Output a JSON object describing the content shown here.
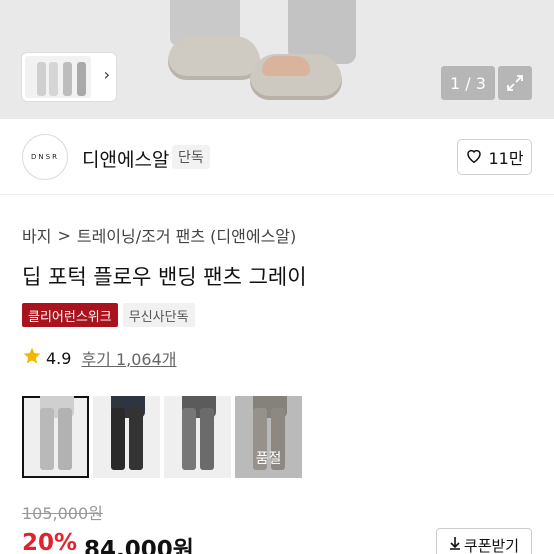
{
  "hero": {
    "page_counter": "1 / 3"
  },
  "icons": {
    "thumbnail_next": "chevron-right-icon",
    "expand": "expand-icon",
    "like": "heart-icon",
    "rating": "star-icon",
    "coupon": "download-arrow-icon"
  },
  "brand": {
    "logo_text": "DNSR",
    "name": "디앤에스알",
    "badge": "단독",
    "like_count": "11만"
  },
  "breadcrumb": {
    "items": [
      "바지",
      "트레이닝/조거 팬츠 (디앤에스알)"
    ],
    "separator": ">"
  },
  "product": {
    "title": "딥 포턱 플로우 밴딩 팬츠 그레이",
    "tags": [
      "클리어런스위크",
      "무신사단독"
    ],
    "rating": "4.9",
    "reviews": "후기 1,064개"
  },
  "options": [
    {
      "label": "",
      "selected": true,
      "sold_out": false
    },
    {
      "label": "",
      "selected": false,
      "sold_out": false
    },
    {
      "label": "",
      "selected": false,
      "sold_out": false
    },
    {
      "label": "품절",
      "selected": false,
      "sold_out": true
    }
  ],
  "price": {
    "original": "105,000원",
    "discount": "20%",
    "sale": "84,000원",
    "coupon_label": "쿠폰받기"
  },
  "colors": {
    "accent_red": "#e3232c",
    "tag_red": "#a8131d",
    "star": "#f5b700"
  }
}
